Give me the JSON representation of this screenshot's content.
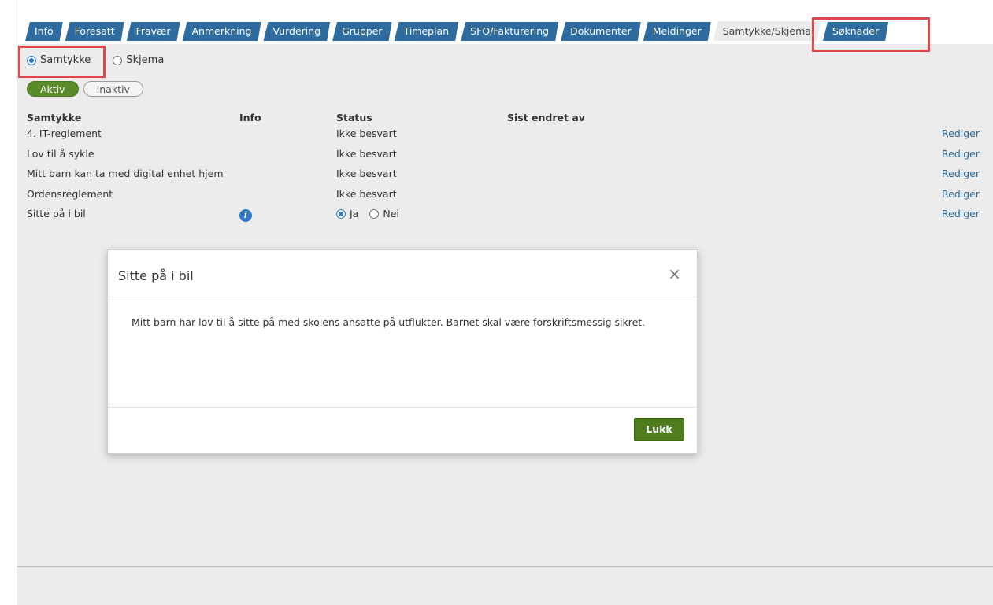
{
  "tabs": [
    {
      "label": "Info",
      "active": false
    },
    {
      "label": "Foresatt",
      "active": false
    },
    {
      "label": "Fravær",
      "active": false
    },
    {
      "label": "Anmerkning",
      "active": false
    },
    {
      "label": "Vurdering",
      "active": false
    },
    {
      "label": "Grupper",
      "active": false
    },
    {
      "label": "Timeplan",
      "active": false
    },
    {
      "label": "SFO/Fakturering",
      "active": false
    },
    {
      "label": "Dokumenter",
      "active": false
    },
    {
      "label": "Meldinger",
      "active": false
    },
    {
      "label": "Samtykke/Skjema",
      "active": true
    },
    {
      "label": "Søknader",
      "active": false
    }
  ],
  "mode": {
    "options": [
      {
        "label": "Samtykke",
        "selected": true
      },
      {
        "label": "Skjema",
        "selected": false
      }
    ]
  },
  "filter": {
    "active_label": "Aktiv",
    "inactive_label": "Inaktiv"
  },
  "table": {
    "headers": {
      "name": "Samtykke",
      "info": "Info",
      "status": "Status",
      "changed_by": "Sist endret av"
    },
    "rows": [
      {
        "name": "4. IT-reglement",
        "status": "Ikke besvart",
        "action": "Rediger"
      },
      {
        "name": "Lov til å sykle",
        "status": "Ikke besvart",
        "action": "Rediger"
      },
      {
        "name": "Mitt barn kan ta med digital enhet hjem",
        "status": "Ikke besvart",
        "action": "Rediger"
      },
      {
        "name": "Ordensreglement",
        "status": "Ikke besvart",
        "action": "Rediger"
      },
      {
        "name": "Sitte på i bil",
        "info_icon": "info-icon",
        "yes_label": "Ja",
        "no_label": "Nei",
        "selected": "Ja",
        "action": "Rediger"
      }
    ]
  },
  "modal": {
    "title": "Sitte på i bil",
    "close_glyph": "×",
    "body": "Mitt barn har lov til å sitte på med skolens ansatte på utflukter. Barnet skal være forskriftsmessig sikret.",
    "button": "Lukk"
  },
  "colors": {
    "tab": "#2e6b9e",
    "accent_green": "#5a8a2a",
    "highlight": "#e0474c"
  }
}
